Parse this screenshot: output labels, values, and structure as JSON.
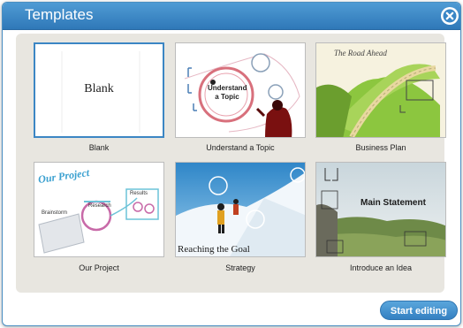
{
  "dialog": {
    "title": "Templates",
    "close_icon": "close-icon",
    "start_label": "Start editing"
  },
  "templates": [
    {
      "caption": "Blank",
      "thumb_text": "Blank",
      "selected": true
    },
    {
      "caption": "Understand a Topic",
      "thumb_text": "Understand a Topic"
    },
    {
      "caption": "Business Plan",
      "thumb_text": "The Road Ahead"
    },
    {
      "caption": "Our Project",
      "thumb_text": "Our Project",
      "sub_labels": [
        "Brainstorm",
        "Research",
        "Results"
      ]
    },
    {
      "caption": "Strategy",
      "thumb_text": "Reaching the Goal"
    },
    {
      "caption": "Introduce an Idea",
      "thumb_text": "Main Statement"
    }
  ],
  "colors": {
    "accent": "#3c86c4",
    "title_bar": "#3f8ac9",
    "panel": "#e8e6e0"
  }
}
